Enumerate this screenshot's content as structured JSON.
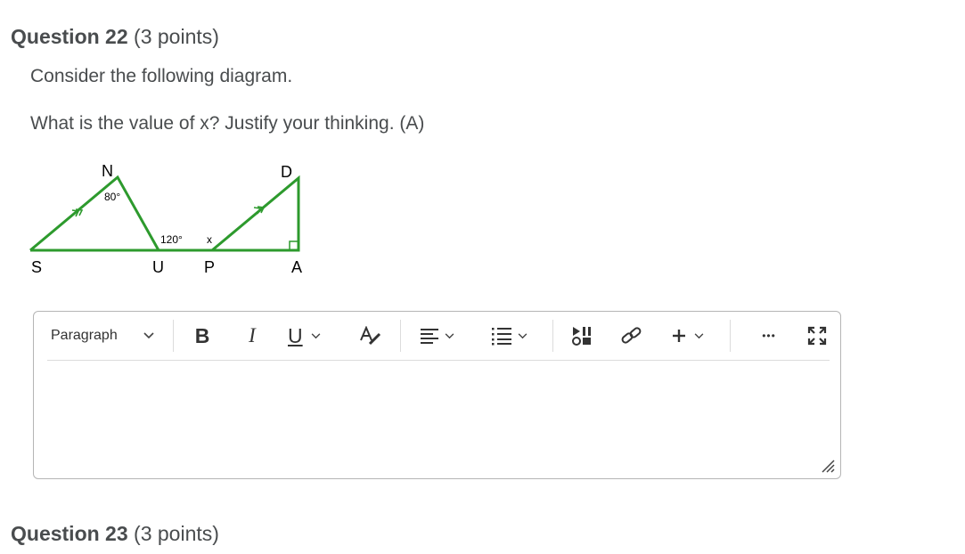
{
  "question22": {
    "title": "Question 22",
    "points": "(3 points)"
  },
  "prompt_line1": "Consider the following diagram.",
  "prompt_line2": "What is the value of x? Justify your thinking. (A)",
  "diagram": {
    "labels": {
      "N": "N",
      "D": "D",
      "S": "S",
      "U": "U",
      "P": "P",
      "A": "A"
    },
    "angle_n": "80°",
    "angle_u": "120°",
    "angle_x": "x"
  },
  "editor": {
    "format_label": "Paragraph",
    "bold_label": "B",
    "italic_label": "I",
    "underline_label": "U",
    "more_label": "•••"
  },
  "question23": {
    "title": "Question 23",
    "points": "(3 points)"
  },
  "colors": {
    "diagram_green": "#2d9a2d",
    "text": "#494c4e"
  }
}
